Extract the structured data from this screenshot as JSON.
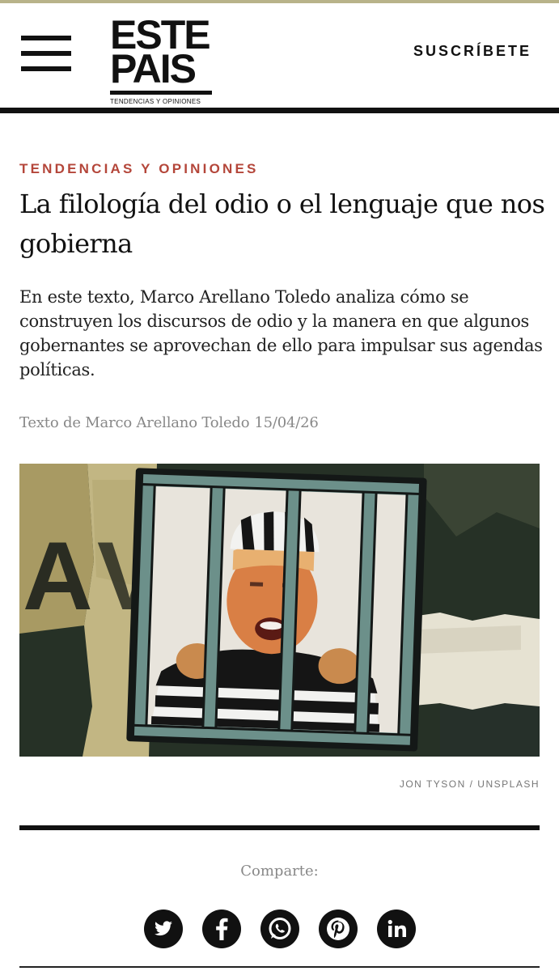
{
  "header": {
    "menu_icon": "hamburger-menu-icon",
    "logo": {
      "line1": "ESTE",
      "line2": "PAIS",
      "tagline": "TENDENCIAS Y OPINIONES"
    },
    "subscribe_label": "SUSCRÍBETE"
  },
  "article": {
    "kicker": "TENDENCIAS Y OPINIONES",
    "title": "La filología del odio o el lenguaje que nos gobierna",
    "dek": "En este texto, Marco Arellano Toledo analiza cómo se construyen los discursos de odio y la manera en que algunos gobernantes se aprovechan de ello para impulsar sus agendas políticas.",
    "byline": "Texto de Marco Arellano Toledo",
    "date": "15/04/26",
    "image_credit": "JON TYSON / UNSPLASH"
  },
  "share": {
    "label": "Comparte:",
    "buttons": [
      {
        "name": "twitter",
        "icon": "twitter-bird-icon"
      },
      {
        "name": "facebook",
        "icon": "facebook-f-icon"
      },
      {
        "name": "whatsapp",
        "icon": "whatsapp-icon"
      },
      {
        "name": "pinterest",
        "icon": "pinterest-icon"
      },
      {
        "name": "linkedin",
        "icon": "linkedin-in-icon"
      }
    ]
  },
  "colors": {
    "kicker": "#b4463a",
    "meta_gray": "#888888",
    "ink": "#111111",
    "top_line": "#b8b38a"
  }
}
